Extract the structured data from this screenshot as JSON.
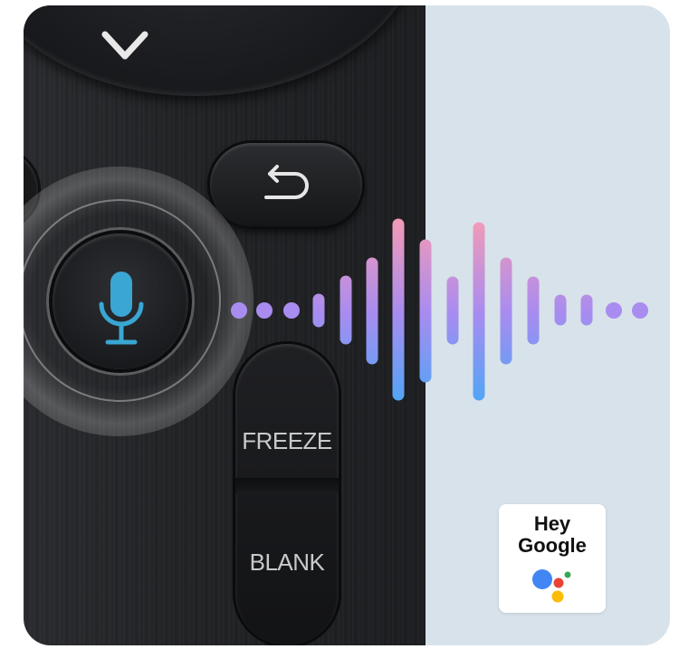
{
  "remote": {
    "freeze_label": "FREEZE",
    "blank_label": "BLANK",
    "icons": [
      "chevron-down-icon",
      "back-arrow-icon",
      "microphone-icon"
    ],
    "mic_color": "#3aa6d2"
  },
  "assistant_badge": {
    "line1": "Hey",
    "line2": "Google",
    "dot_colors": [
      "#4285F4",
      "#EA4335",
      "#FBBC05",
      "#34A853"
    ]
  },
  "wave_colors": {
    "top": "#f09ab8",
    "mid": "#a88cf0",
    "bottom": "#4fa6f5"
  }
}
